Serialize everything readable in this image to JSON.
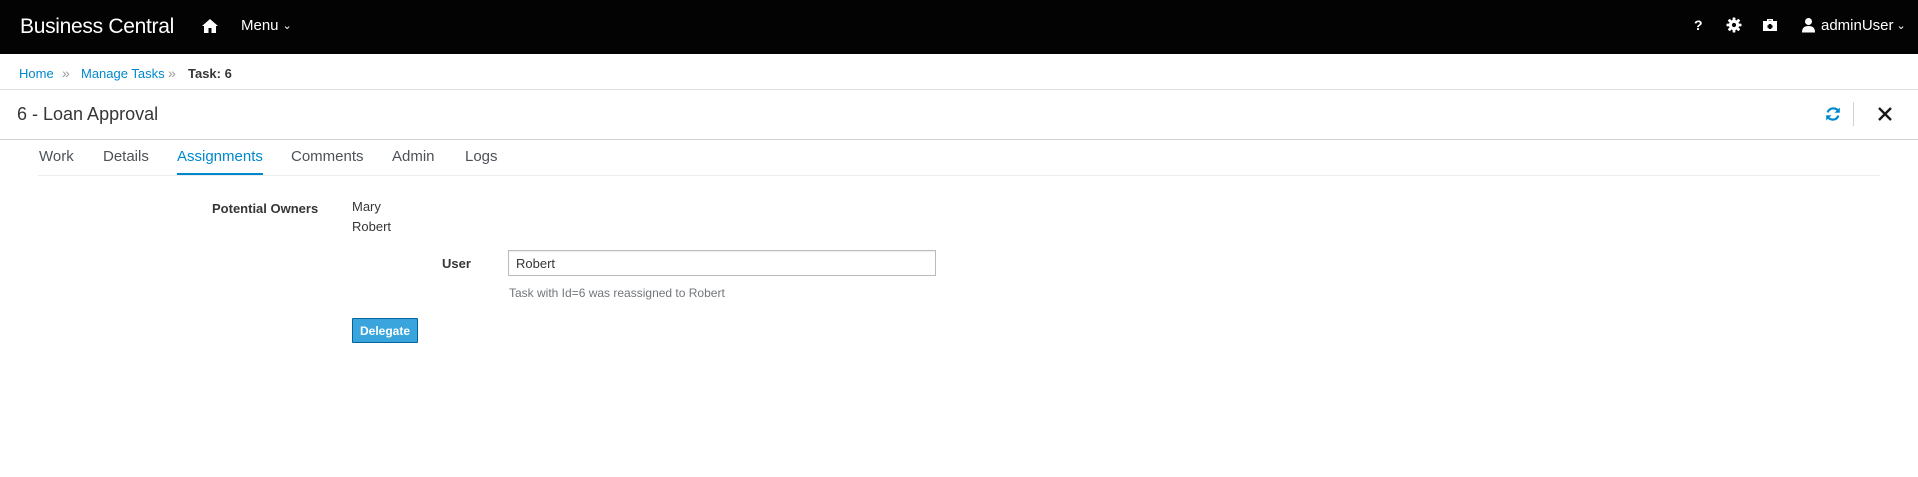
{
  "app": {
    "title": "Business Central"
  },
  "nav": {
    "menu_label": "Menu",
    "help_label": "?",
    "user_label": "adminUser"
  },
  "breadcrumb": {
    "home": "Home",
    "separator": "»",
    "manage_tasks": "Manage Tasks",
    "current": "Task: 6"
  },
  "page": {
    "title": "6 - Loan Approval"
  },
  "tabs": [
    {
      "label": "Work"
    },
    {
      "label": "Details"
    },
    {
      "label": "Assignments",
      "active": true
    },
    {
      "label": "Comments"
    },
    {
      "label": "Admin"
    },
    {
      "label": "Logs"
    }
  ],
  "assignments": {
    "potential_owners_label": "Potential Owners",
    "owners": [
      "Mary",
      "Robert"
    ],
    "user_label": "User",
    "user_value": "Robert",
    "help_text": "Task with Id=6 was reassigned to Robert",
    "delegate_label": "Delegate"
  },
  "colors": {
    "topbar": "#030303",
    "accent": "#0088ce",
    "button": "#39a5dc"
  },
  "icons": [
    "home-icon",
    "chevron-down-icon",
    "question-icon",
    "gear-icon",
    "briefcase-icon",
    "user-icon",
    "refresh-icon",
    "close-icon"
  ]
}
